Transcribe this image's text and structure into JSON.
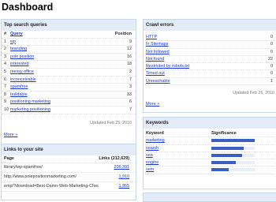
{
  "page": {
    "title": "Dashboard"
  },
  "top_queries": {
    "title": "Top search queries",
    "col_rank": "#",
    "col_query": "Query",
    "col_position": "Position",
    "rows": [
      {
        "rank": "1",
        "query": "wp",
        "position": "9"
      },
      {
        "rank": "2",
        "query": "branding",
        "position": "12"
      },
      {
        "rank": "3",
        "query": "pole position",
        "position": "16"
      },
      {
        "rank": "4",
        "query": "interested",
        "position": "18"
      },
      {
        "rank": "5",
        "query": "messy office",
        "position": "2"
      },
      {
        "rank": "6",
        "query": "inconceivable",
        "position": "7"
      },
      {
        "rank": "7",
        "query": "spamfree",
        "position": "3"
      },
      {
        "rank": "8",
        "query": "buildable",
        "position": "33"
      },
      {
        "rank": "9",
        "query": "positioning marketing",
        "position": "6"
      },
      {
        "rank": "10",
        "query": "marketing positioning",
        "position": "7"
      }
    ],
    "updated": "Updated Feb 25, 2010",
    "more": "More »"
  },
  "crawl_errors": {
    "title": "Crawl errors",
    "rows": [
      {
        "label": "HTTP",
        "count": "0"
      },
      {
        "label": "In Sitemaps",
        "count": "0"
      },
      {
        "label": "Not followed",
        "count": "0"
      },
      {
        "label": "Not found",
        "count": "22"
      },
      {
        "label": "Restricted by robots.txt",
        "count": "0"
      },
      {
        "label": "Timed out",
        "count": "0"
      },
      {
        "label": "Unreachable",
        "count": "1"
      }
    ],
    "updated": "Updated Feb 25, 2010",
    "more": "More »"
  },
  "links": {
    "title": "Links to your site",
    "col_page": "Page",
    "col_links": "Links (212,629)",
    "rows": [
      {
        "page": "library/wp-spamfree/",
        "links": "206,391"
      },
      {
        "page": "http://www.polepositionmarketing.com/",
        "links": "1,910"
      },
      {
        "page": "emp/?download=Best-Damn-Web-Marketing-Checkli",
        "links": "1,955"
      }
    ]
  },
  "keywords": {
    "title": "Keywords",
    "col_keyword": "Keyword",
    "col_significance": "Significance",
    "rows": [
      {
        "keyword": "marketing",
        "significance": 1.0
      },
      {
        "keyword": "search",
        "significance": 0.74
      },
      {
        "keyword": "seo",
        "significance": 0.7
      },
      {
        "keyword": "engine",
        "significance": 0.56
      },
      {
        "keyword": "sem",
        "significance": 0.4
      }
    ]
  },
  "colors": {
    "link": "#1a35d8",
    "header_bg": "#e5ecf9",
    "border": "#c5d7ef",
    "bar": "#3b5fc2"
  }
}
